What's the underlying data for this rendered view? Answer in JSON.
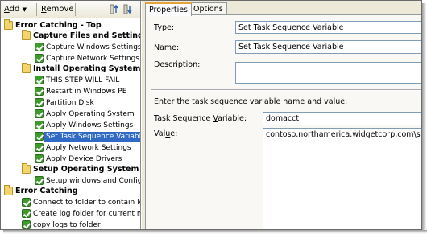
{
  "toolbar": {
    "add_label": "Add",
    "add_accel": "A",
    "add_rest": "dd",
    "remove_label": "Remove",
    "remove_accel": "R",
    "remove_rest": "emove"
  },
  "tree": [
    {
      "label": "Error Catching - Top",
      "type": "group",
      "level": 0
    },
    {
      "label": "Capture Files and Settings",
      "type": "group",
      "level": 1
    },
    {
      "label": "Capture Windows Settings",
      "type": "step",
      "level": 2
    },
    {
      "label": "Capture Network Settings",
      "type": "step",
      "level": 2
    },
    {
      "label": "Install Operating System",
      "type": "group",
      "level": 1
    },
    {
      "label": "THIS STEP WILL FAIL",
      "type": "step",
      "level": 2
    },
    {
      "label": "Restart in Windows PE",
      "type": "step",
      "level": 2
    },
    {
      "label": "Partition Disk",
      "type": "step",
      "level": 2
    },
    {
      "label": "Apply Operating System",
      "type": "step",
      "level": 2
    },
    {
      "label": "Apply Windows Settings",
      "type": "step",
      "level": 2
    },
    {
      "label": "Set Task Sequence Variable",
      "type": "step",
      "level": 2,
      "selected": true
    },
    {
      "label": "Apply Network Settings",
      "type": "step",
      "level": 2
    },
    {
      "label": "Apply Device Drivers",
      "type": "step",
      "level": 2
    },
    {
      "label": "Setup Operating System",
      "type": "group",
      "level": 1
    },
    {
      "label": "Setup windows and ConfigM",
      "type": "step",
      "level": 2
    },
    {
      "label": "Error Catching",
      "type": "group",
      "level": 0
    },
    {
      "label": "Connect to folder to contain logs",
      "type": "step",
      "level": 1
    },
    {
      "label": "Create log folder for current mach",
      "type": "step",
      "level": 1
    },
    {
      "label": "copy logs to folder",
      "type": "step",
      "level": 1
    }
  ],
  "tabs": [
    {
      "label": "Properties",
      "active": true
    },
    {
      "label": "Options",
      "active": false
    }
  ],
  "properties": {
    "type_label": "Type:",
    "type_value": "Set Task Sequence Variable",
    "name_label": "Name:",
    "name_value": "Set Task Sequence Variable",
    "description_label": "Description:",
    "description_value": "",
    "instructions": "Enter the task sequence variable name and value.",
    "variable_label": "Task Sequence Variable:",
    "variable_value": "domacct",
    "value_label": "Value:",
    "value_value": "contoso.northamerica.widgetcorp.com\\stevereac"
  },
  "colors": {
    "selection": "#316ac5",
    "panel_bg": "#ece9d8",
    "active_tab_accent": "#e6a23b",
    "step_check": "#3f9a2e",
    "group_folder": "#f3d56c"
  }
}
